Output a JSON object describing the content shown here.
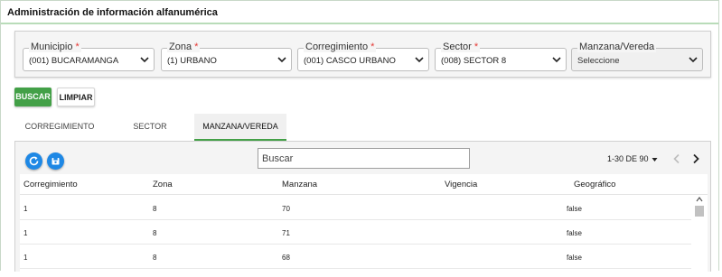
{
  "header": {
    "title": "Administración de información alfanumérica"
  },
  "filters": [
    {
      "label": "Municipio",
      "required": true,
      "value": "(001) BUCARAMANGA",
      "disabled": false
    },
    {
      "label": "Zona",
      "required": true,
      "value": "(1) URBANO",
      "disabled": false
    },
    {
      "label": "Corregimiento",
      "required": true,
      "value": "(001) CASCO URBANO",
      "disabled": false
    },
    {
      "label": "Sector",
      "required": true,
      "value": "(008) SECTOR 8",
      "disabled": false
    },
    {
      "label": "Manzana/Vereda",
      "required": false,
      "value": "Seleccione",
      "disabled": true
    }
  ],
  "required_mark": "*",
  "actions": {
    "search_label": "BUSCAR",
    "clear_label": "LIMPIAR"
  },
  "tabs": [
    {
      "label": "CORREGIMIENTO",
      "active": false
    },
    {
      "label": "SECTOR",
      "active": false
    },
    {
      "label": "MANZANA/VEREDA",
      "active": true
    }
  ],
  "table": {
    "toolbar_icons": [
      "refresh-icon",
      "save-icon"
    ],
    "search_placeholder": "Buscar",
    "pagination": "1-30 DE 90",
    "columns": [
      "Corregimiento",
      "Zona",
      "Manzana",
      "Vigencia",
      "Geográfico"
    ],
    "rows": [
      [
        "1",
        "8",
        "70",
        "",
        "false"
      ],
      [
        "1",
        "8",
        "71",
        "",
        "false"
      ],
      [
        "1",
        "8",
        "68",
        "",
        "false"
      ]
    ]
  },
  "colors": {
    "primary_green": "#43a047",
    "icon_blue": "#1e88e5",
    "required_red": "#e53935"
  }
}
